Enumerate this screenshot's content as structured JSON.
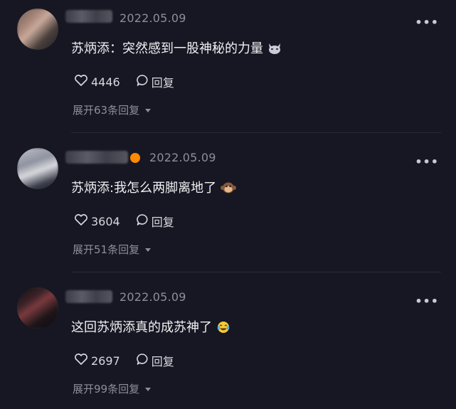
{
  "comments": [
    {
      "date": "2022.05.09",
      "text": "苏炳添：突然感到一股神秘的力量",
      "emoji": "cat-face-emoji",
      "likes": "4446",
      "reply_label": "回复",
      "expand_label": "展开63条回复",
      "has_vip_badge": false
    },
    {
      "date": "2022.05.09",
      "text": "苏炳添:我怎么两脚离地了",
      "emoji": "monkey-face-emoji",
      "likes": "3604",
      "reply_label": "回复",
      "expand_label": "展开51条回复",
      "has_vip_badge": true
    },
    {
      "date": "2022.05.09",
      "text": "这回苏炳添真的成苏神了",
      "emoji": "tears-of-joy-emoji",
      "likes": "2697",
      "reply_label": "回复",
      "expand_label": "展开99条回复",
      "has_vip_badge": false
    }
  ],
  "more_icon": "more-dots-icon",
  "colors": {
    "background": "#161722",
    "text": "#f0f0f3",
    "muted": "#8d8e98",
    "badge": "#ff8a00"
  }
}
